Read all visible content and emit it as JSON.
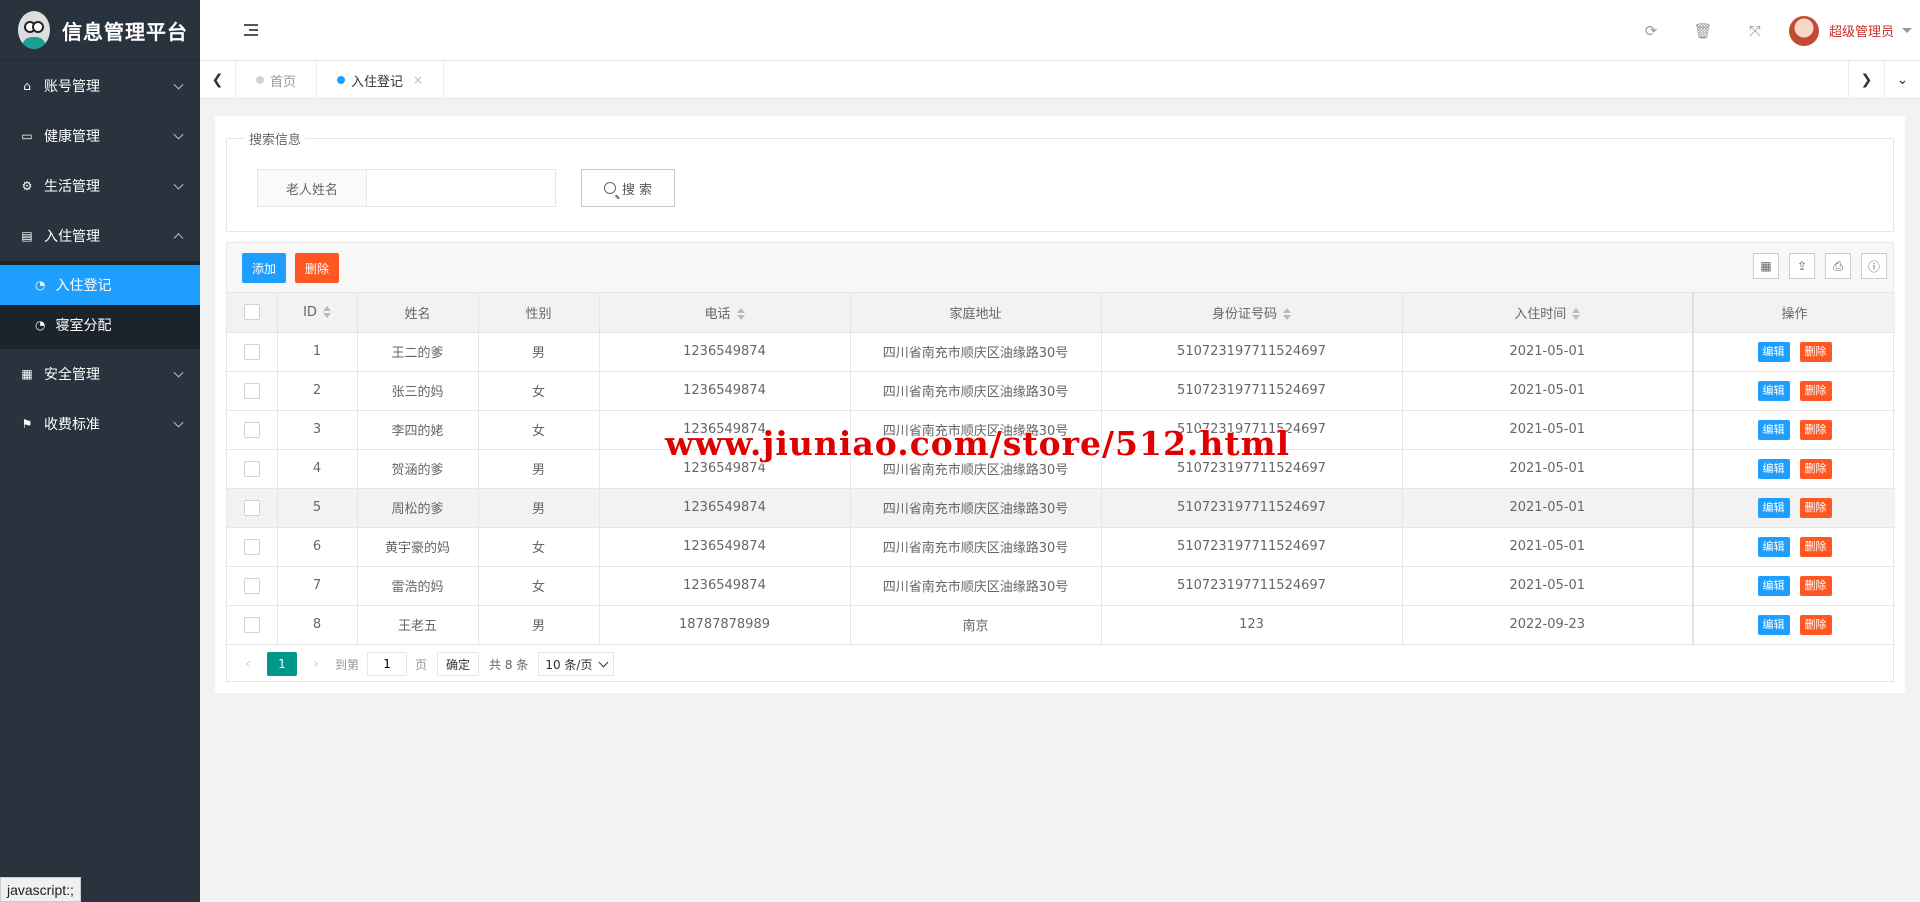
{
  "app": {
    "title": "信息管理平台"
  },
  "sidebar": {
    "items": [
      {
        "label": "账号管理",
        "icon": "home-icon",
        "expanded": false
      },
      {
        "label": "健康管理",
        "icon": "window-icon",
        "expanded": false
      },
      {
        "label": "生活管理",
        "icon": "gears-icon",
        "expanded": false
      },
      {
        "label": "入住管理",
        "icon": "file-icon",
        "expanded": true
      },
      {
        "label": "安全管理",
        "icon": "calendar-icon",
        "expanded": false
      },
      {
        "label": "收费标准",
        "icon": "flag-icon",
        "expanded": false
      }
    ],
    "subitems": [
      {
        "label": "入住登记",
        "icon": "dashboard-icon",
        "active": true
      },
      {
        "label": "寝室分配",
        "icon": "dashboard-icon",
        "active": false
      }
    ]
  },
  "header": {
    "user_name": "超级管理员",
    "icons": [
      "refresh-icon",
      "trash-icon",
      "fullscreen-icon"
    ]
  },
  "tabs": [
    {
      "label": "首页",
      "active": false
    },
    {
      "label": "入住登记",
      "active": true,
      "close": "×"
    }
  ],
  "search": {
    "legend": "搜索信息",
    "field_label": "老人姓名",
    "input_value": "",
    "button_label": "搜 索"
  },
  "toolbar": {
    "add_label": "添加",
    "delete_label": "删除"
  },
  "table": {
    "columns": [
      "ID",
      "姓名",
      "性别",
      "电话",
      "家庭地址",
      "身份证号码",
      "入住时间",
      "操作"
    ],
    "rows": [
      {
        "id": "1",
        "name": "王二的爹",
        "gender": "男",
        "phone": "1236549874",
        "address": "四川省南充市顺庆区油缘路30号",
        "id_card": "510723197711524697",
        "date": "2021-05-01"
      },
      {
        "id": "2",
        "name": "张三的妈",
        "gender": "女",
        "phone": "1236549874",
        "address": "四川省南充市顺庆区油缘路30号",
        "id_card": "510723197711524697",
        "date": "2021-05-01"
      },
      {
        "id": "3",
        "name": "李四的姥",
        "gender": "女",
        "phone": "1236549874",
        "address": "四川省南充市顺庆区油缘路30号",
        "id_card": "510723197711524697",
        "date": "2021-05-01"
      },
      {
        "id": "4",
        "name": "贺涵的爹",
        "gender": "男",
        "phone": "1236549874",
        "address": "四川省南充市顺庆区油缘路30号",
        "id_card": "510723197711524697",
        "date": "2021-05-01"
      },
      {
        "id": "5",
        "name": "周松的爹",
        "gender": "男",
        "phone": "1236549874",
        "address": "四川省南充市顺庆区油缘路30号",
        "id_card": "510723197711524697",
        "date": "2021-05-01"
      },
      {
        "id": "6",
        "name": "黄宇豪的妈",
        "gender": "女",
        "phone": "1236549874",
        "address": "四川省南充市顺庆区油缘路30号",
        "id_card": "510723197711524697",
        "date": "2021-05-01"
      },
      {
        "id": "7",
        "name": "雷浩的妈",
        "gender": "女",
        "phone": "1236549874",
        "address": "四川省南充市顺庆区油缘路30号",
        "id_card": "510723197711524697",
        "date": "2021-05-01"
      },
      {
        "id": "8",
        "name": "王老五",
        "gender": "男",
        "phone": "18787878989",
        "address": "南京",
        "id_card": "123",
        "date": "2022-09-23"
      }
    ],
    "row_actions": {
      "edit": "编辑",
      "delete": "删除"
    }
  },
  "pager": {
    "current_page": "1",
    "goto_prefix": "到第",
    "goto_value": "1",
    "goto_suffix": "页",
    "confirm": "确定",
    "total": "共 8 条",
    "limit": "10 条/页"
  },
  "watermark": "www.jiuniao.com/store/512.html",
  "statusbar": "javascript:;",
  "colors": {
    "sidebar_bg": "#28333e",
    "active_blue": "#1e9fff",
    "danger": "#ff5722",
    "pager_green": "#009688"
  }
}
